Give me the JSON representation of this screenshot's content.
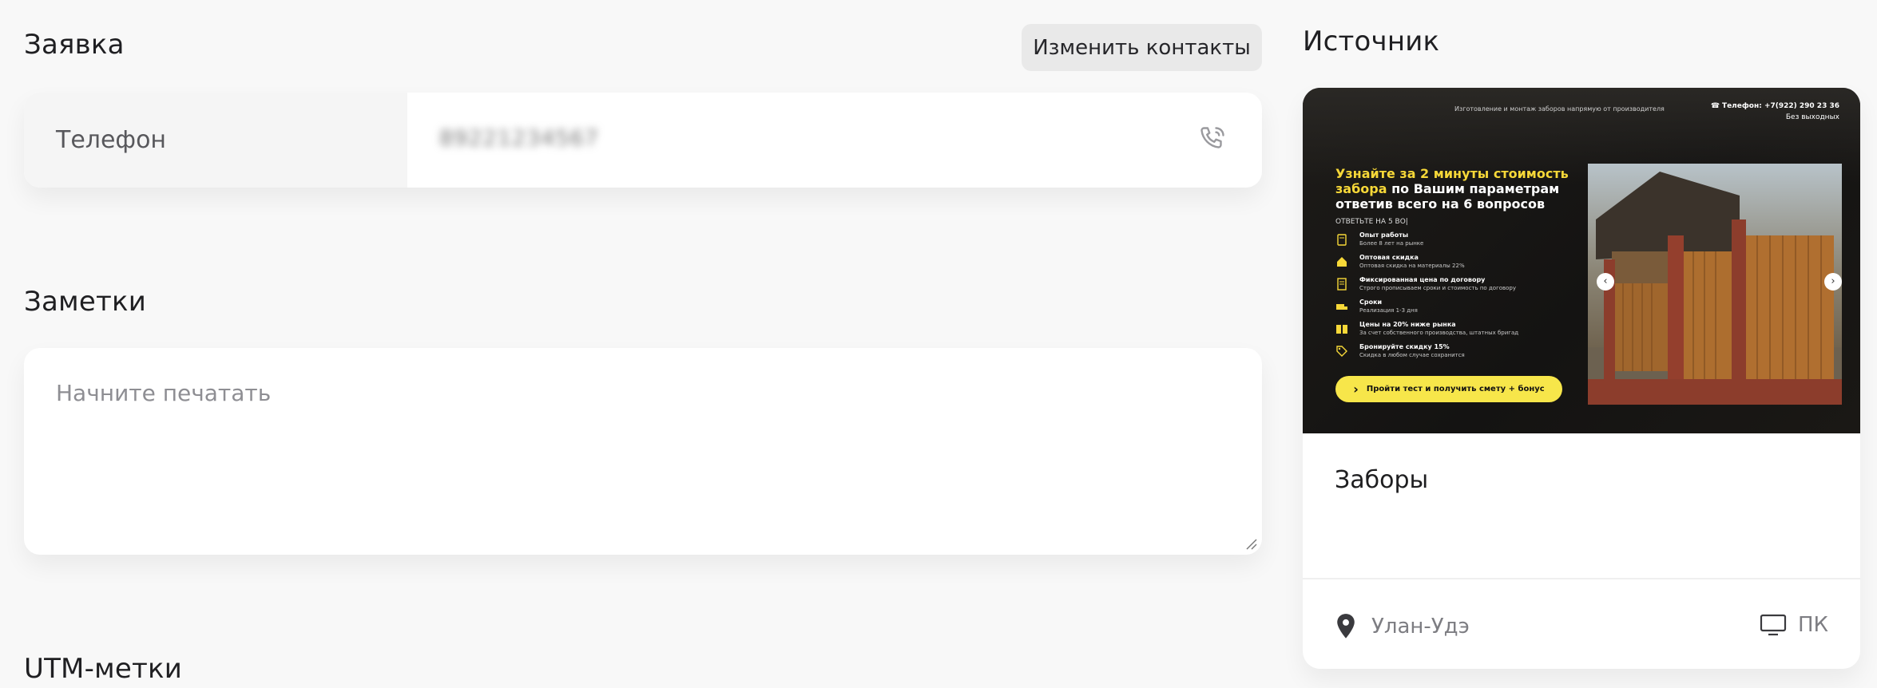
{
  "request": {
    "title": "Заявка",
    "change_contacts_label": "Изменить контакты",
    "phone_label": "Телефон",
    "phone_value": "89221234567"
  },
  "notes": {
    "title": "Заметки",
    "placeholder": "Начните печатать",
    "value": ""
  },
  "utm": {
    "title": "UTM-метки"
  },
  "source": {
    "title": "Источник",
    "name": "Заборы",
    "city": "Улан-Удэ",
    "device": "ПК",
    "preview": {
      "top_line": "Изготовление и монтаж заборов напрямую от производителя",
      "phone_line": "Телефон: +7(922) 290 23 36",
      "hours_line": "Без выходных",
      "headline_yellow": "Узнайте за 2 минуты стоимость забора",
      "headline_white": "по Вашим параметрам ответив всего на 6 вопросов",
      "subhead": "ОТВЕТЬТЕ НА 5 ВО|",
      "items": [
        {
          "title": "Опыт работы",
          "desc": "Более 8 лет на рынке"
        },
        {
          "title": "Оптовая скидка",
          "desc": "Оптовая скидка на материалы 22%"
        },
        {
          "title": "Фиксированная цена по договору",
          "desc": "Строго прописываем сроки и стоимость по договору"
        },
        {
          "title": "Сроки",
          "desc": "Реализация 1-3 дня"
        },
        {
          "title": "Цены на 20% ниже рынка",
          "desc": "За счет собственного производства, штатных бригад"
        },
        {
          "title": "Бронируйте скидку 15%",
          "desc": "Скидка в любом случае сохранится"
        }
      ],
      "cta": "Пройти тест и получить смету + бонус",
      "accent_color": "#f7e64a"
    }
  }
}
